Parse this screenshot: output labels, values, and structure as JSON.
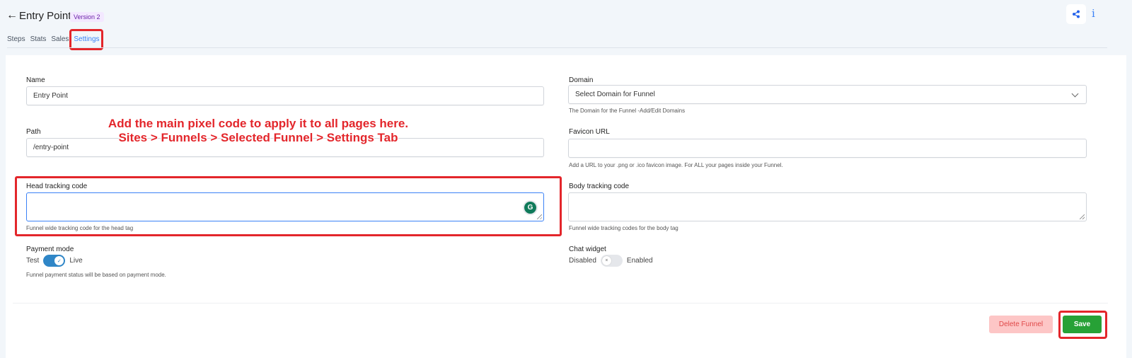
{
  "header": {
    "title": "Entry Point",
    "version_badge": "Version 2",
    "back_icon": "arrow-left-icon",
    "share_icon": "share-icon",
    "info_icon": "info-icon",
    "info_glyph": "i",
    "back_glyph": "←"
  },
  "tabs": [
    {
      "label": "Steps",
      "active": false
    },
    {
      "label": "Stats",
      "active": false
    },
    {
      "label": "Sales",
      "active": false
    },
    {
      "label": "Settings",
      "active": true
    }
  ],
  "form": {
    "name": {
      "label": "Name",
      "value": "Entry Point"
    },
    "path": {
      "label": "Path",
      "value": "/entry-point"
    },
    "head_tracking": {
      "label": "Head tracking code",
      "value": "",
      "help": "Funnel wide tracking code for the head tag",
      "grammarly_glyph": "G"
    },
    "payment_mode": {
      "label": "Payment mode",
      "off_label": "Test",
      "on_label": "Live",
      "enabled": true,
      "knob_glyph": "✓",
      "help": "Funnel payment status will be based on payment mode."
    },
    "domain": {
      "label": "Domain",
      "placeholder": "Select Domain for Funnel",
      "help": "The Domain for the Funnel -Add/Edit Domains"
    },
    "favicon": {
      "label": "Favicon URL",
      "value": "",
      "help": "Add a URL to your .png or .ico favicon image. For ALL your pages inside your Funnel."
    },
    "body_tracking": {
      "label": "Body tracking code",
      "value": "",
      "help": "Funnel wide tracking codes for the body tag"
    },
    "chat_widget": {
      "label": "Chat widget",
      "off_label": "Disabled",
      "on_label": "Enabled",
      "enabled": false,
      "knob_glyph": "×"
    }
  },
  "annotation": {
    "line1": "Add the main pixel code to apply it to all pages here.",
    "line2": "Sites > Funnels > Selected Funnel > Settings Tab",
    "color": "#e3262b"
  },
  "footer": {
    "delete_label": "Delete Funnel",
    "save_label": "Save"
  },
  "colors": {
    "accent": "#3b82f6",
    "save": "#27a136",
    "delete_bg": "#fdc6c6",
    "toggle_on": "#2f86c7"
  }
}
